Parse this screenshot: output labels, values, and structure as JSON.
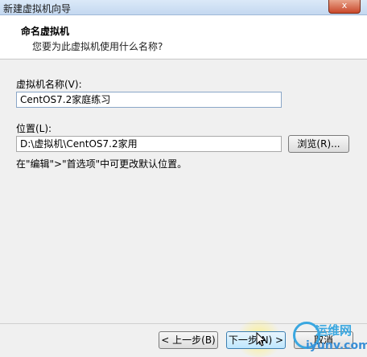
{
  "window": {
    "title": "新建虚拟机向导",
    "close_label": "x"
  },
  "header": {
    "title": "命名虚拟机",
    "subtitle": "您要为此虚拟机使用什么名称?"
  },
  "form": {
    "name_label": "虚拟机名称(V):",
    "name_value": "CentOS7.2家庭练习",
    "location_label": "位置(L):",
    "location_value": "D:\\虚拟机\\CentOS7.2家用",
    "browse_label": "浏览(R)...",
    "hint": "在\"编辑\">\"首选项\"中可更改默认位置。"
  },
  "footer": {
    "back_label": "< 上一步(B)",
    "next_label": "下一步(N) >",
    "cancel_label": "取消"
  },
  "watermark": {
    "brand": "运维网",
    "url": "iyunv.com"
  }
}
